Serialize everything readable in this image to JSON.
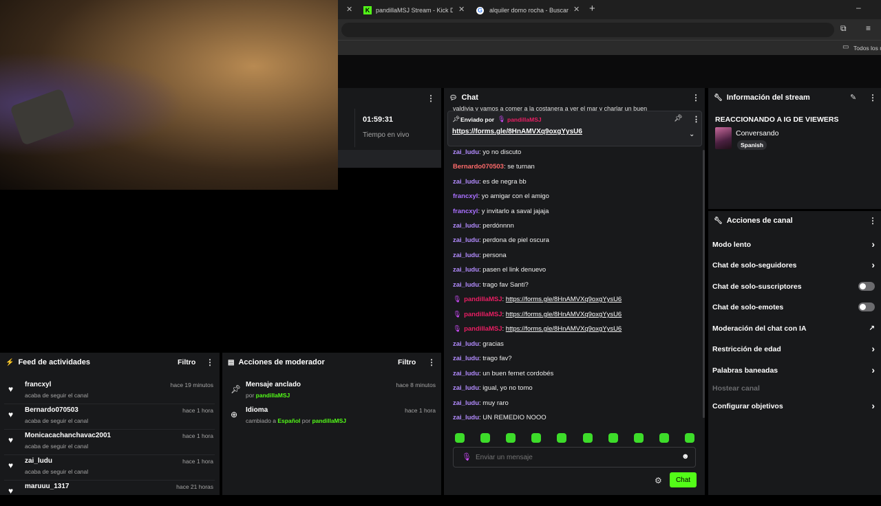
{
  "browser": {
    "tabs": [
      {
        "label": "pandillaMSJ Stream - Kick Dash"
      },
      {
        "label": "alquiler domo rocha - Buscar co"
      }
    ],
    "new_tab": "+",
    "bookmarks_all": "Todos los m"
  },
  "stats": {
    "time": "01:59:31",
    "time_label": "Tiempo en vivo"
  },
  "activity_feed": {
    "title": "Feed de actividades",
    "filter": "Filtro",
    "items": [
      {
        "name": "francxyl",
        "sub": "acaba de seguir el canal",
        "time": "hace 19 minutos"
      },
      {
        "name": "Bernardo070503",
        "sub": "acaba de seguir el canal",
        "time": "hace 1 hora"
      },
      {
        "name": "Monicacachanchavac2001",
        "sub": "acaba de seguir el canal",
        "time": "hace 1 hora"
      },
      {
        "name": "zai_ludu",
        "sub": "acaba de seguir el canal",
        "time": "hace 1 hora"
      },
      {
        "name": "maruuu_1317",
        "sub": "",
        "time": "hace 21 horas"
      }
    ]
  },
  "mod_actions": {
    "title": "Acciones de moderador",
    "filter": "Filtro",
    "items": [
      {
        "title": "Mensaje anclado",
        "by_prefix": "por",
        "by_user": "pandillaMSJ",
        "time": "hace 8 minutos"
      },
      {
        "title": "Idioma",
        "by_prefix": "cambiado a",
        "lang": "Español",
        "by_mid": "por",
        "by_user": "pandillaMSJ",
        "time": "hace 1 hora"
      }
    ]
  },
  "chat": {
    "title": "Chat",
    "truncated_line": "valdivia y vamos a comer a la costanera a ver el mar y charlar un buen",
    "pinned": {
      "label": "Enviado por",
      "user": "pandillaMSJ",
      "link": "https://forms.gle/8HnAMVXq9oxgYysU6"
    },
    "messages": [
      {
        "user": "zai_ludu",
        "cls": "u-zai",
        "text": "yo no discuto"
      },
      {
        "user": "Bernardo070503",
        "cls": "u-bern",
        "text": "se turnan"
      },
      {
        "user": "zai_ludu",
        "cls": "u-zai",
        "text": "es de negra bb"
      },
      {
        "user": "francxyl",
        "cls": "u-fran",
        "text": "yo amigar con el amigo"
      },
      {
        "user": "francxyl",
        "cls": "u-fran",
        "text": "y invitarlo a saval jajaja"
      },
      {
        "user": "zai_ludu",
        "cls": "u-zai",
        "text": "perdónnnn"
      },
      {
        "user": "zai_ludu",
        "cls": "u-zai",
        "text": "perdona de piel oscura"
      },
      {
        "user": "zai_ludu",
        "cls": "u-zai",
        "text": "persona"
      },
      {
        "user": "zai_ludu",
        "cls": "u-zai",
        "text": "pasen el link denuevo"
      },
      {
        "user": "zai_ludu",
        "cls": "u-zai",
        "text": "trago fav Santi?"
      },
      {
        "user": "pandillaMSJ",
        "cls": "u-pand",
        "text": "https://forms.gle/8HnAMVXq9oxgYysU6",
        "is_link": true
      },
      {
        "user": "pandillaMSJ",
        "cls": "u-pand",
        "text": "https://forms.gle/8HnAMVXq9oxgYysU6",
        "is_link": true
      },
      {
        "user": "pandillaMSJ",
        "cls": "u-pand",
        "text": "https://forms.gle/8HnAMVXq9oxgYysU6",
        "is_link": true
      },
      {
        "user": "zai_ludu",
        "cls": "u-zai",
        "text": "gracias"
      },
      {
        "user": "zai_ludu",
        "cls": "u-zai",
        "text": "trago fav?"
      },
      {
        "user": "zai_ludu",
        "cls": "u-zai",
        "text": "un buen fernet cordobés"
      },
      {
        "user": "zai_ludu",
        "cls": "u-zai",
        "text": "igual, yo no tomo"
      },
      {
        "user": "zai_ludu",
        "cls": "u-zai",
        "text": "muy raro"
      },
      {
        "user": "zai_ludu",
        "cls": "u-zai",
        "text": "UN REMEDIO NOOO"
      }
    ],
    "input_placeholder": "Enviar un mensaje",
    "send_label": "Chat"
  },
  "stream_info": {
    "title": "Información del stream",
    "stream_title": "REACCIONANDO A IG DE VIEWERS",
    "category": "Conversando",
    "language": "Spanish"
  },
  "channel_actions": {
    "title": "Acciones de canal",
    "items": [
      {
        "label": "Modo lento",
        "control": "chevron"
      },
      {
        "label": "Chat de solo-seguidores",
        "control": "chevron"
      },
      {
        "label": "Chat de solo-suscriptores",
        "control": "toggle"
      },
      {
        "label": "Chat de solo-emotes",
        "control": "toggle"
      },
      {
        "label": "Moderación del chat con IA",
        "control": "external"
      },
      {
        "label": "Restricción de edad",
        "control": "chevron"
      },
      {
        "label": "Palabras baneadas",
        "control": "chevron"
      },
      {
        "label": "Hostear canal",
        "control": "disabled"
      },
      {
        "label": "Configurar objetivos",
        "control": "chevron"
      }
    ]
  },
  "colors": {
    "accent": "#53fc18",
    "panel": "#18191b"
  }
}
